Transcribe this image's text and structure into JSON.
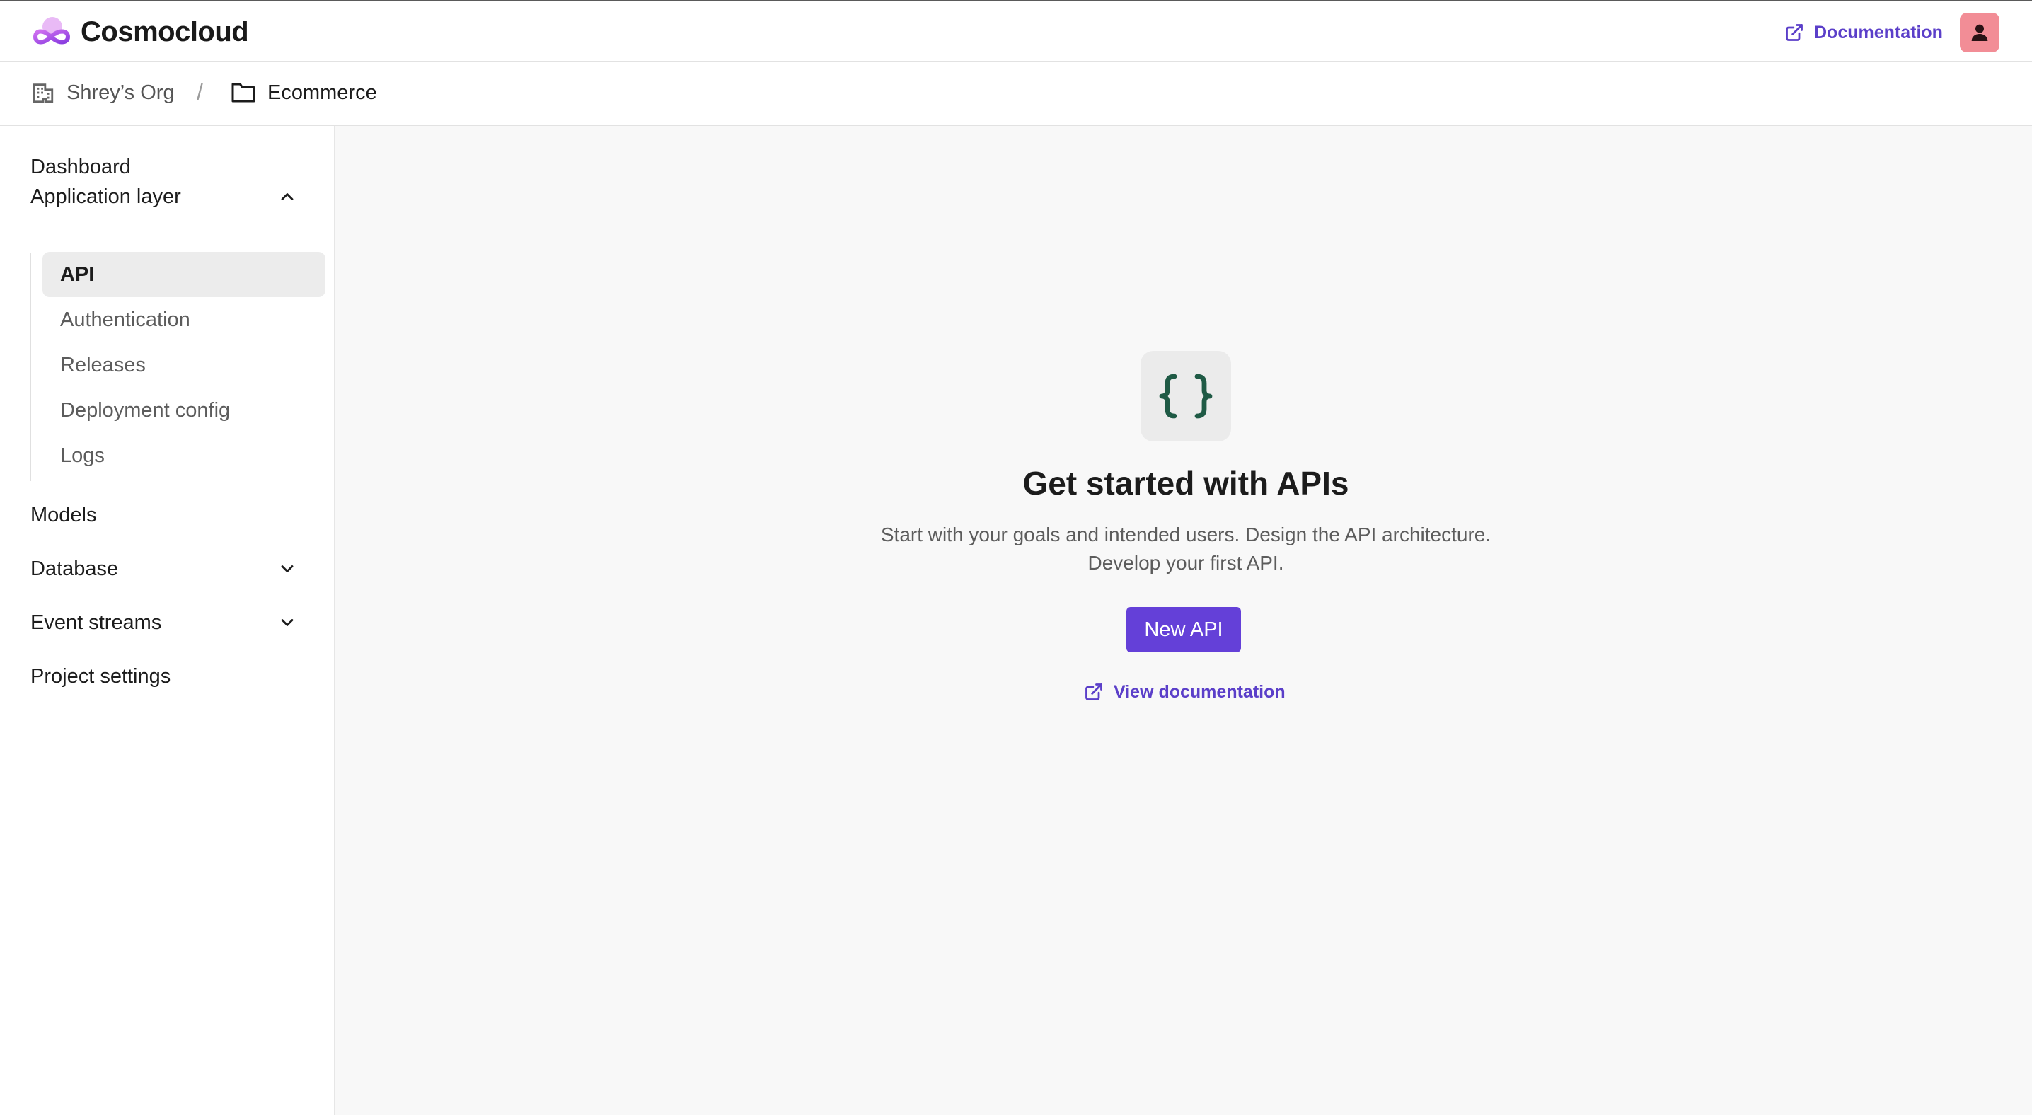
{
  "app": {
    "name": "Cosmocloud"
  },
  "header": {
    "documentation_label": "Documentation",
    "avatar_icon": "user-icon"
  },
  "breadcrumb": {
    "org": "Shrey’s Org",
    "separator": "/",
    "project": "Ecommerce"
  },
  "sidebar": {
    "items": [
      {
        "label": "Dashboard"
      },
      {
        "label": "Application layer",
        "expanded": true
      },
      {
        "label": "Models"
      },
      {
        "label": "Database",
        "expanded": false
      },
      {
        "label": "Event streams",
        "expanded": false
      },
      {
        "label": "Project settings"
      }
    ],
    "application_layer_items": [
      {
        "label": "API",
        "active": true
      },
      {
        "label": "Authentication"
      },
      {
        "label": "Releases"
      },
      {
        "label": "Deployment config"
      },
      {
        "label": "Logs"
      }
    ]
  },
  "empty_state": {
    "icon": "curly-braces-icon",
    "title": "Get started with APIs",
    "description_line1": "Start with your goals and intended users. Design the API architecture.",
    "description_line2": "Develop your first API.",
    "button_label": "New API",
    "link_label": "View documentation"
  },
  "colors": {
    "accent": "#6440d8",
    "link": "#5b3fc9",
    "avatar_bg": "#f28d96",
    "icon_green": "#1f5a45"
  }
}
